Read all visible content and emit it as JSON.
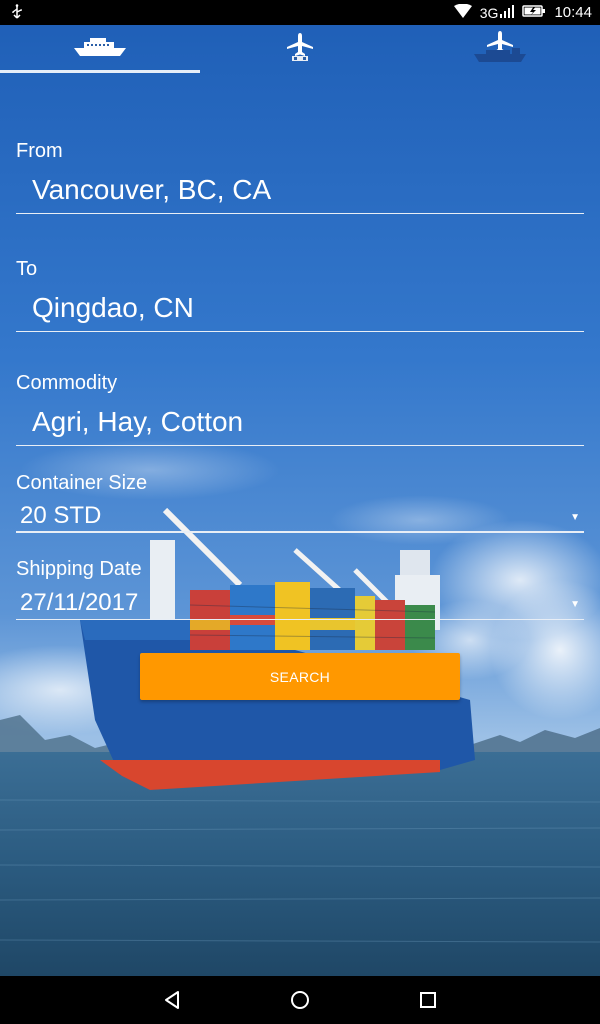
{
  "status_bar": {
    "network_type": "3G",
    "time": "10:44",
    "icons": [
      "usb-icon",
      "wifi-icon",
      "signal-icon",
      "battery-charging-icon"
    ]
  },
  "tabs": [
    {
      "name": "ship",
      "icon": "ship-icon",
      "selected": true
    },
    {
      "name": "air",
      "icon": "airplane-icon",
      "selected": false
    },
    {
      "name": "air-sea",
      "icon": "airplane-ship-icon",
      "selected": false
    }
  ],
  "form": {
    "from_label": "From",
    "from_value": "Vancouver, BC, CA",
    "to_label": "To",
    "to_value": "Qingdao, CN",
    "commodity_label": "Commodity",
    "commodity_value": "Agri, Hay, Cotton",
    "container_size_label": "Container Size",
    "container_size_value": "20 STD",
    "shipping_date_label": "Shipping Date",
    "shipping_date_value": "27/11/2017",
    "search_label": "SEARCH"
  },
  "colors": {
    "accent": "#ff9800",
    "sky": "#2f73c9",
    "sea": "#2c5f84"
  },
  "nav_bar": {
    "icons": [
      "back-icon",
      "home-icon",
      "recents-icon"
    ]
  }
}
